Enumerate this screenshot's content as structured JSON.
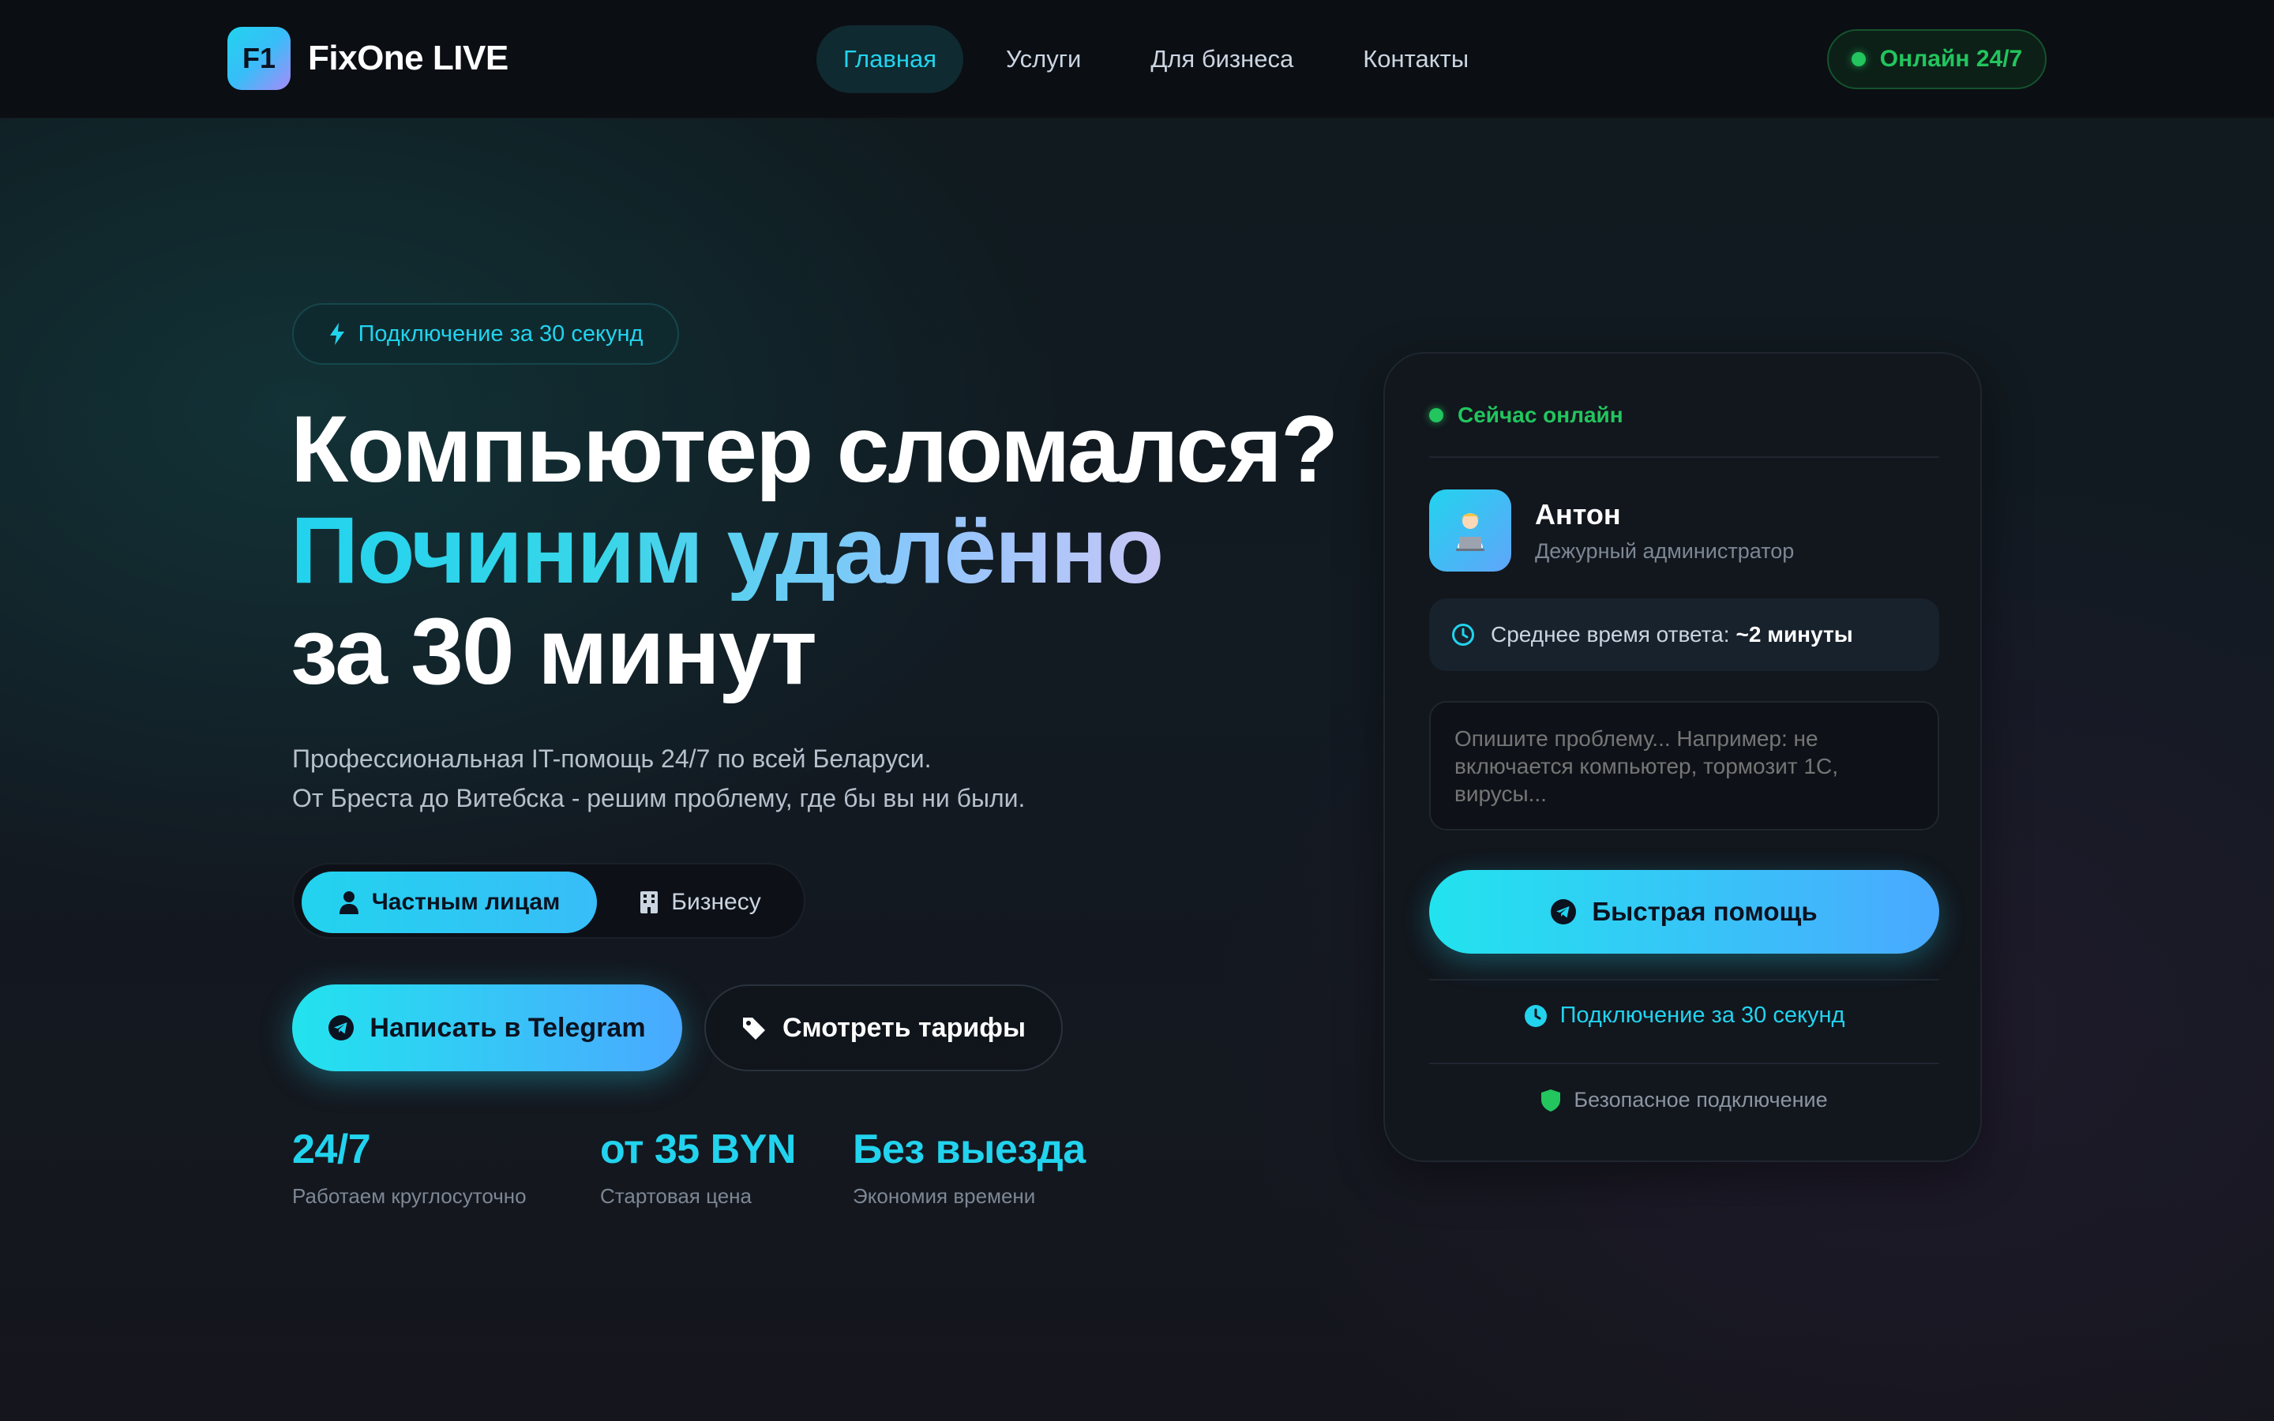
{
  "nav": {
    "logo_mark": "F1",
    "logo_text": "FixOne LIVE",
    "menu": [
      "Главная",
      "Услуги",
      "Для бизнеса",
      "Контакты"
    ],
    "online": "Онлайн 24/7"
  },
  "hero": {
    "badge": "Подключение за 30 секунд",
    "title_line1": "Компьютер сломался?",
    "title_line2": "Починим удалённо",
    "title_line3": "за 30 минут",
    "sub_line1": "Профессиональная IT-помощь 24/7 по всей Беларуси.",
    "sub_line2": "От Бреста до Витебска - решим проблему, где бы вы ни были.",
    "toggle_private": "Частным лицам",
    "toggle_business": "Бизнесу",
    "btn_telegram": "Написать в Telegram",
    "btn_tariffs": "Смотреть тарифы",
    "stats": [
      {
        "value": "24/7",
        "label": "Работаем круглосуточно"
      },
      {
        "value": "от 35 BYN",
        "label": "Стартовая цена"
      },
      {
        "value": "Без выезда",
        "label": "Экономия времени"
      }
    ]
  },
  "card": {
    "status": "Сейчас онлайн",
    "agent_name": "Антон",
    "agent_role": "Дежурный администратор",
    "resp_label": "Среднее время ответа:",
    "resp_value": "~2 минуты",
    "placeholder": "Опишите проблему... Например: не включается компьютер, тормозит 1С, вирусы...",
    "btn_fast": "Быстрая помощь",
    "note_connect": "Подключение за 30 секунд",
    "note_secure": "Безопасное подключение"
  },
  "colors": {
    "accent": "#22d3ee",
    "accent2": "#4aa9ff",
    "online_green": "#22c55e",
    "bg": "#0d1117",
    "card_bg": "#12161d"
  },
  "icons": {
    "badge": "lightning-icon",
    "private": "user-icon",
    "business": "building-icon",
    "telegram": "telegram-icon",
    "tariffs": "tag-icon",
    "clock": "clock-icon",
    "shield": "shield-icon",
    "avatar": "technician-avatar"
  }
}
